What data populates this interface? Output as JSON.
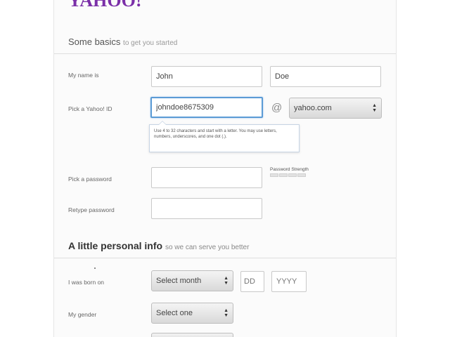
{
  "logo": "YAHOO!",
  "basics": {
    "title": "Some basics",
    "subtitle": "to get you started",
    "name_label": "My name is",
    "first_name": "John",
    "last_name": "Doe",
    "yahoo_id_label": "Pick a Yahoo! ID",
    "yahoo_id_value": "johndoe8675309",
    "at_sign": "@",
    "domain_select": "yahoo.com",
    "id_hint": "Use 4 to 32 characters and start with a letter. You may use letters, numbers, underscores, and one dot (.).",
    "password_label": "Pick a password",
    "password_strength_label": "Password Strength",
    "retype_label": "Retype password"
  },
  "personal": {
    "title": "A little personal info",
    "subtitle": "so we can serve you better",
    "birth_label": "I was born on",
    "month_select": "Select month",
    "day_placeholder": "DD",
    "year_placeholder": "YYYY",
    "gender_label": "My gender",
    "gender_select": "Select one"
  },
  "colors": {
    "brand": "#7b2fa8",
    "focus_border": "#5b9bd5"
  }
}
